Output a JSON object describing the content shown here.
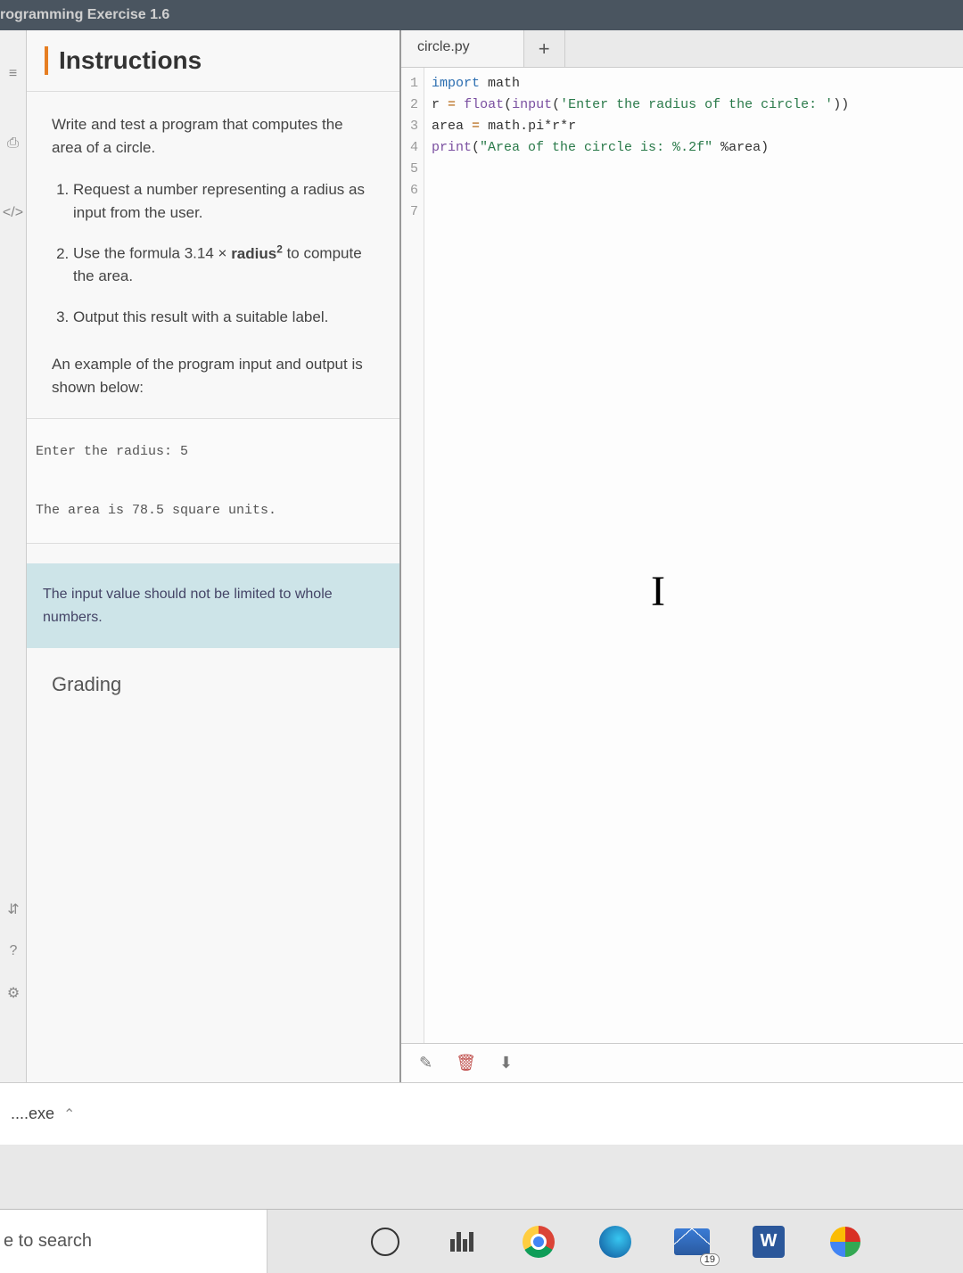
{
  "breadcrumb": "rogramming Exercise 1.6",
  "leftRail": {
    "i1": "≡",
    "i2": "⎙",
    "i3": "</>",
    "i4": "⇵",
    "i5": "?",
    "i6": "⚙"
  },
  "instructions": {
    "title": "Instructions",
    "intro": "Write and test a program that computes the area of a circle.",
    "steps": [
      "Request a number representing a radius as input from the user.",
      "Use the formula 3.14 × radius² to compute the area.",
      "Output this result with a suitable label."
    ],
    "exampleLead": "An example of the program input and output is shown below:",
    "sample1": "Enter the radius: 5",
    "sample2": "The area is 78.5 square units.",
    "note": "The input value should not be limited to whole numbers.",
    "grading": "Grading"
  },
  "editor": {
    "tab": "circle.py",
    "plus": "+",
    "gutter": [
      "1",
      "2",
      "3",
      "4",
      "5",
      "6",
      "7"
    ],
    "code": {
      "l1": {
        "kw": "import",
        "mod": "math"
      },
      "l2": {
        "var": "r",
        "eq": "=",
        "fn": "float",
        "open": "(",
        "inp": "input",
        "op2": "(",
        "str": "'Enter the radius of the circle: '",
        "close": "))"
      },
      "l3": {
        "var": "area",
        "eq": "=",
        "expr": "math.pi*r*r"
      },
      "l4": {
        "fn": "print",
        "open": "(",
        "str": "\"Area of the circle is: %.2f\"",
        "pct": " %area",
        "close": ")"
      }
    },
    "footer": {
      "pen": "✎",
      "trash": "🗑",
      "down": "⬇"
    }
  },
  "download": {
    "file": "....exe",
    "chev": "⌃"
  },
  "taskbar": {
    "search": "e to search",
    "mailBadge": "19",
    "word": "W"
  }
}
